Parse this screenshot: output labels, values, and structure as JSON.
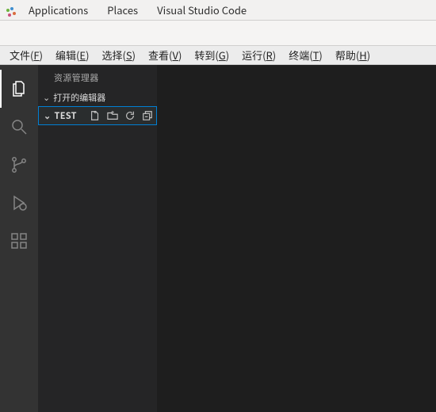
{
  "gnome": {
    "applications": "Applications",
    "places": "Places",
    "app_name": "Visual Studio Code"
  },
  "menu": {
    "file": "文件(F)",
    "edit": "编辑(E)",
    "selection": "选择(S)",
    "view": "查看(V)",
    "go": "转到(G)",
    "run": "运行(R)",
    "terminal": "终端(T)",
    "help": "帮助(H)"
  },
  "sidebar": {
    "title": "资源管理器",
    "open_editors": "打开的编辑器",
    "folder_name": "TEST"
  }
}
